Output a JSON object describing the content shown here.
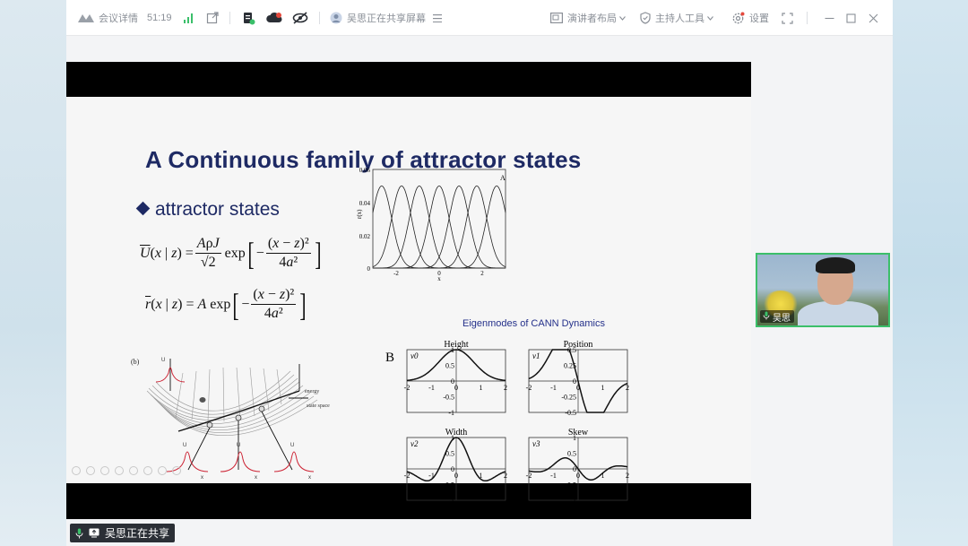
{
  "toolbar": {
    "meeting_details_label": "会议详情",
    "elapsed_time": "51:19",
    "sharing_status_label": "吴思正在共享屏幕",
    "speaker_layout_label": "演讲者布局",
    "host_tools_label": "主持人工具",
    "settings_label": "设置"
  },
  "slide": {
    "title": "A Continuous family of attractor states",
    "bullet": "attractor states",
    "eigen_title": "Eigenmodes of CANN Dynamics",
    "fig_a": {
      "panel_label": "A",
      "ylabel": "r(x)",
      "xlabel": "x",
      "yticks": [
        "0",
        "0.02",
        "0.04",
        "0.06"
      ],
      "xticks": [
        "-2",
        "0",
        "2"
      ]
    },
    "fig_b": {
      "panel_label": "B",
      "panels": [
        {
          "title": "Height",
          "mode": "v0",
          "yticks": [
            "1",
            "0.5",
            "0",
            "-0.5",
            "-1"
          ]
        },
        {
          "title": "Position",
          "mode": "v1",
          "yticks": [
            "0.5",
            "0.25",
            "0",
            "-0.25",
            "-0.5"
          ]
        },
        {
          "title": "Width",
          "mode": "v2",
          "yticks": [
            "1",
            "0.5",
            "0",
            "-0.5",
            "-1"
          ]
        },
        {
          "title": "Skew",
          "mode": "v3",
          "yticks": [
            "1",
            "0.5",
            "0",
            "-0.5",
            "-1"
          ]
        }
      ],
      "xticks": [
        "-2",
        "-1",
        "0",
        "1",
        "2"
      ]
    },
    "landscape_labels": {
      "panel": "(b)",
      "energy": "energy",
      "state_space": "state space",
      "u": "U",
      "x": "x"
    }
  },
  "video": {
    "participant_name": "吴思"
  },
  "sharebar": {
    "label": "吴思正在共享"
  },
  "colors": {
    "title_blue": "#1e2a64",
    "eigen_blue": "#24308a",
    "video_border": "#3bbf6a"
  }
}
